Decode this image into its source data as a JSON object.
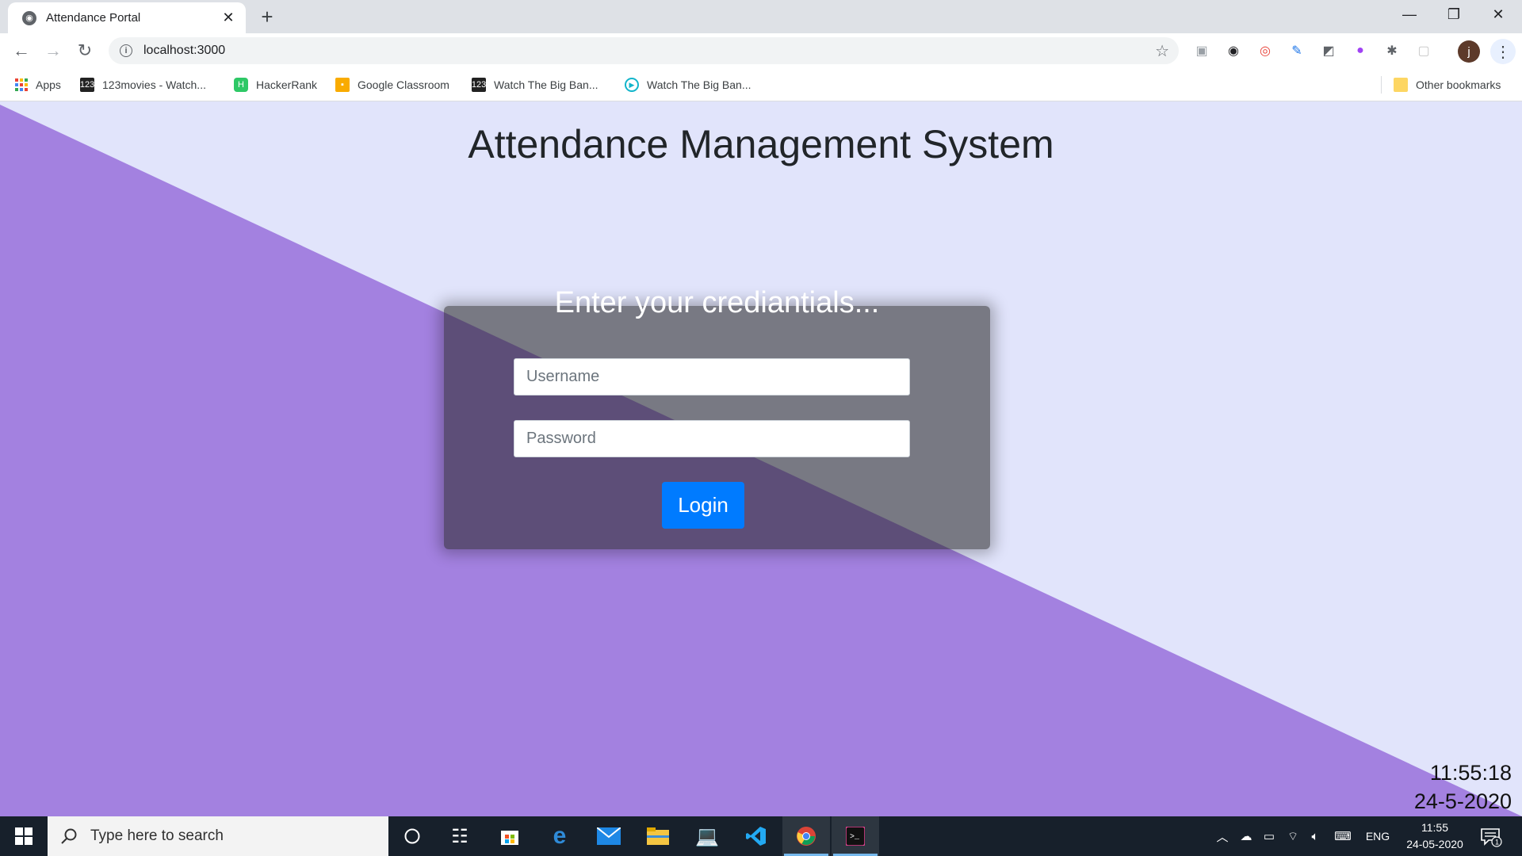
{
  "browser": {
    "tab_title": "Attendance Portal",
    "tab_close": "✕",
    "new_tab": "+",
    "url": "localhost:3000",
    "window_controls": {
      "minimize": "—",
      "restore": "❐",
      "close": "✕"
    },
    "profile_initial": "j",
    "bookmarks": [
      {
        "label": "Apps",
        "icon": "apps-grid-icon"
      },
      {
        "label": "123movies - Watch...",
        "icon": "123movies-icon"
      },
      {
        "label": "HackerRank",
        "icon": "hackerrank-icon"
      },
      {
        "label": "Google Classroom",
        "icon": "classroom-icon"
      },
      {
        "label": "Watch The Big Ban...",
        "icon": "movie-site-icon"
      },
      {
        "label": "Watch The Big Ban...",
        "icon": "play-circle-icon"
      }
    ],
    "other_bookmarks": "Other bookmarks"
  },
  "page": {
    "title": "Attendance Management System",
    "card_heading": "Enter your crediantials...",
    "username_placeholder": "Username",
    "password_placeholder": "Password",
    "login_label": "Login",
    "clock_time": "11:55:18",
    "clock_date": "24-5-2020",
    "colors": {
      "purple": "#a381e0",
      "lavender": "#e1e4fb",
      "button": "#007bff"
    }
  },
  "taskbar": {
    "search_placeholder": "Type here to search",
    "language": "ENG",
    "time": "11:55",
    "date": "24-05-2020",
    "notification_count": "1"
  }
}
